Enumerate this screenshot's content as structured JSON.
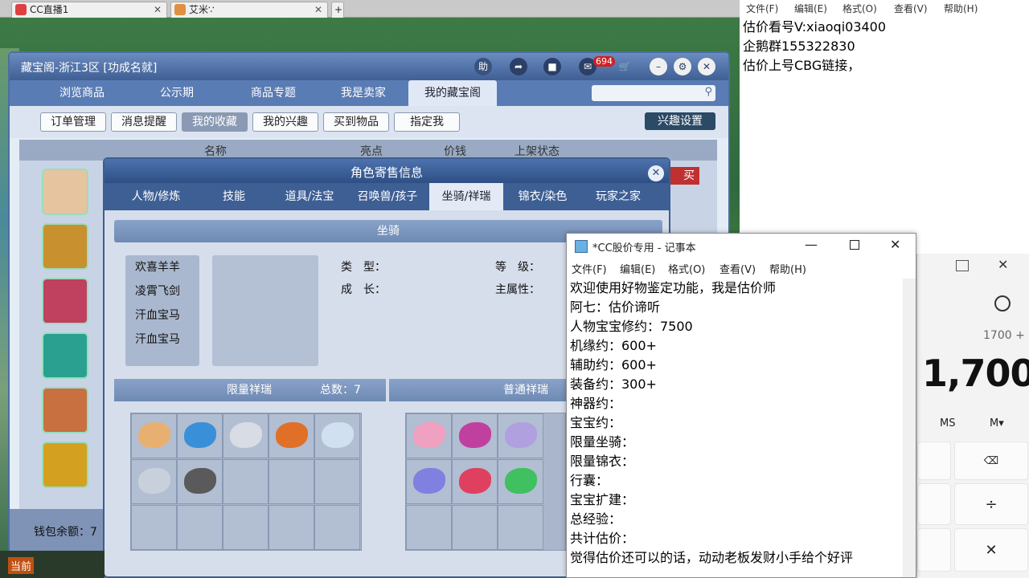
{
  "browser_tabs": [
    {
      "label": "CC直播1"
    },
    {
      "label": "艾米∵"
    }
  ],
  "right_notepad": {
    "menu": [
      "文件(F)",
      "编辑(E)",
      "格式(O)",
      "查看(V)",
      "帮助(H)"
    ],
    "lines": [
      "估价看号V:xiaoqi03400",
      "企鹅群155322830",
      "估价上号CBG链接，"
    ]
  },
  "window": {
    "title": "藏宝阁-浙江3区 [功成名就]",
    "help_label": "助",
    "cart_badge": "694",
    "tabs": [
      "浏览商品",
      "公示期",
      "商品专题",
      "我是卖家",
      "我的藏宝阁"
    ],
    "active_tab": "我的藏宝阁",
    "subtabs": [
      "订单管理",
      "消息提醒",
      "我的收藏",
      "我的兴趣",
      "买到物品",
      "指定我"
    ],
    "active_subtab": "我的收藏",
    "interest_settings": "兴趣设置",
    "columns": [
      "名称",
      "亮点",
      "价钱",
      "上架状态"
    ],
    "wallet_label": "钱包余额：7",
    "buy_label": "买"
  },
  "dialog": {
    "title": "角色寄售信息",
    "close": "✕",
    "tabs": [
      "人物/修炼",
      "技能",
      "道具/法宝",
      "召唤兽/孩子",
      "坐骑/祥瑞",
      "锦衣/染色",
      "玩家之家"
    ],
    "active_tab": "坐骑/祥瑞",
    "mount_header": "坐骑",
    "mounts": [
      "欢喜羊羊",
      "凌霄飞剑",
      "汗血宝马",
      "汗血宝马"
    ],
    "type_label": "类　型：",
    "level_label": "等　级：",
    "growth_label": "成　长：",
    "main_attr_label": "主属性：",
    "limited_header": "限量祥瑞",
    "total_label": "总数：7",
    "normal_header": "普通祥瑞"
  },
  "notepad": {
    "title": "*CC股价专用 - 记事本",
    "menu": [
      "文件(F)",
      "编辑(E)",
      "格式(O)",
      "查看(V)",
      "帮助(H)"
    ],
    "lines": [
      "欢迎使用好物鉴定功能，我是估价师",
      "阿七：估价谛听",
      "人物宝宝修约：7500",
      "机缘约：600+",
      "辅助约：600+",
      "装备约：300+",
      "神器约：",
      "宝宝约：",
      "限量坐骑：",
      "限量锦衣：",
      "行囊：",
      "宝宝扩建：",
      "总经验：",
      "共计估价：",
      "觉得估价还可以的话，动动老板发财小手给个好评"
    ]
  },
  "calculator": {
    "expression": "1700 +",
    "display": "1,700",
    "ms": "MS",
    "mplus": "M▾"
  },
  "hud": {
    "label": "当前"
  },
  "pet_colors": [
    "#e8b070",
    "#3a90d8",
    "#d8dce4",
    "#e07028",
    "#d0e0f0",
    "#c8d0dc",
    "#5a5a5a",
    "#f0a0c0",
    "#c040a0",
    "#b0a0e0",
    "#8080e0",
    "#e04060",
    "#40c060"
  ],
  "avatar_colors": [
    "#e6c4a0",
    "#c8902e",
    "#c04060",
    "#2aa090",
    "#c87040",
    "#d4a020"
  ]
}
